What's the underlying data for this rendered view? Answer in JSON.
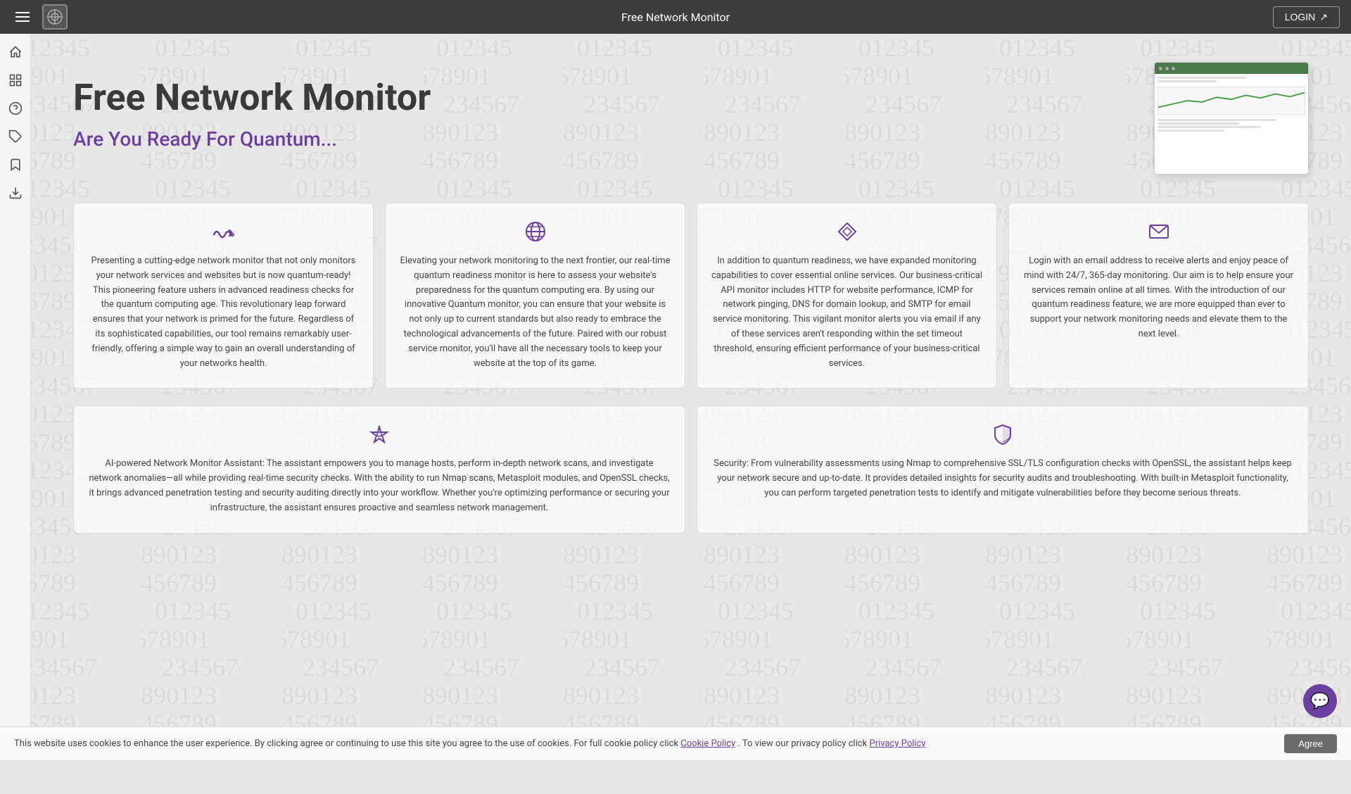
{
  "navbar": {
    "title": "Free Network Monitor",
    "login_label": "LOGIN",
    "logo_alt": "logo"
  },
  "sidebar": {
    "items": [
      {
        "icon": "home",
        "label": "Home"
      },
      {
        "icon": "dashboard",
        "label": "Dashboard"
      },
      {
        "icon": "help",
        "label": "Help"
      },
      {
        "icon": "tags",
        "label": "Tags"
      },
      {
        "icon": "bookmark",
        "label": "Bookmark"
      },
      {
        "icon": "download",
        "label": "Download"
      }
    ]
  },
  "hero": {
    "title": "Free Network Monitor",
    "subtitle": "Are You Ready For Quantum..."
  },
  "features": [
    {
      "icon": "wave",
      "text": "Presenting a cutting-edge network monitor that not only monitors your network services and websites but is now quantum-ready! This pioneering feature ushers in advanced readiness checks for the quantum computing age. This revolutionary leap forward ensures that your network is primed for the future. Regardless of its sophisticated capabilities, our tool remains remarkably user-friendly, offering a simple way to gain an overall understanding of your networks health."
    },
    {
      "icon": "globe",
      "text": "Elevating your network monitoring to the next frontier, our real-time quantum readiness monitor is here to assess your website's preparedness for the quantum computing era. By using our innovative Quantum monitor, you can ensure that your website is not only up to current standards but also ready to embrace the technological advancements of the future. Paired with our robust service monitor, you'll have all the necessary tools to keep your website at the top of its game."
    },
    {
      "icon": "diamond",
      "text": "In addition to quantum readiness, we have expanded monitoring capabilities to cover essential online services. Our business-critical API monitor includes HTTP for website performance, ICMP for network pinging, DNS for domain lookup, and SMTP for email service monitoring. This vigilant monitor alerts you via email if any of these services aren't responding within the set timeout threshold, ensuring efficient performance of your business-critical services."
    },
    {
      "icon": "mail",
      "text": "Login with an email address to receive alerts and enjoy peace of mind with 24/7, 365-day monitoring. Our aim is to help ensure your services remain online at all times. With the introduction of our quantum readiness feature, we are more equipped than ever to support your network monitoring needs and elevate them to the next level."
    }
  ],
  "features2": [
    {
      "icon": "star",
      "text": "AI-powered Network Monitor Assistant: The assistant empowers you to manage hosts, perform in-depth network scans, and investigate network anomalies—all while providing real-time security checks. With the ability to run Nmap scans, Metasploit modules, and OpenSSL checks, it brings advanced penetration testing and security auditing directly into your workflow. Whether you're optimizing performance or securing your infrastructure, the assistant ensures proactive and seamless network management."
    },
    {
      "icon": "shield",
      "text": "Security: From vulnerability assessments using Nmap to comprehensive SSL/TLS configuration checks with OpenSSL, the assistant helps keep your network secure and up-to-date. It provides detailed insights for security audits and troubleshooting. With built-in Metasploit functionality, you can perform targeted penetration tests to identify and mitigate vulnerabilities before they become serious threats."
    }
  ],
  "cookie": {
    "text": "This website uses cookies to enhance the user experience. By clicking agree or continuing to use this site you agree to the use of cookies. For full cookie policy click ",
    "cookie_link": "Cookie Policy",
    "privacy_text": ". To view our privacy policy click ",
    "privacy_link": "Privacy Policy",
    "agree_label": "Agree"
  },
  "chat": {
    "icon": "💬"
  }
}
